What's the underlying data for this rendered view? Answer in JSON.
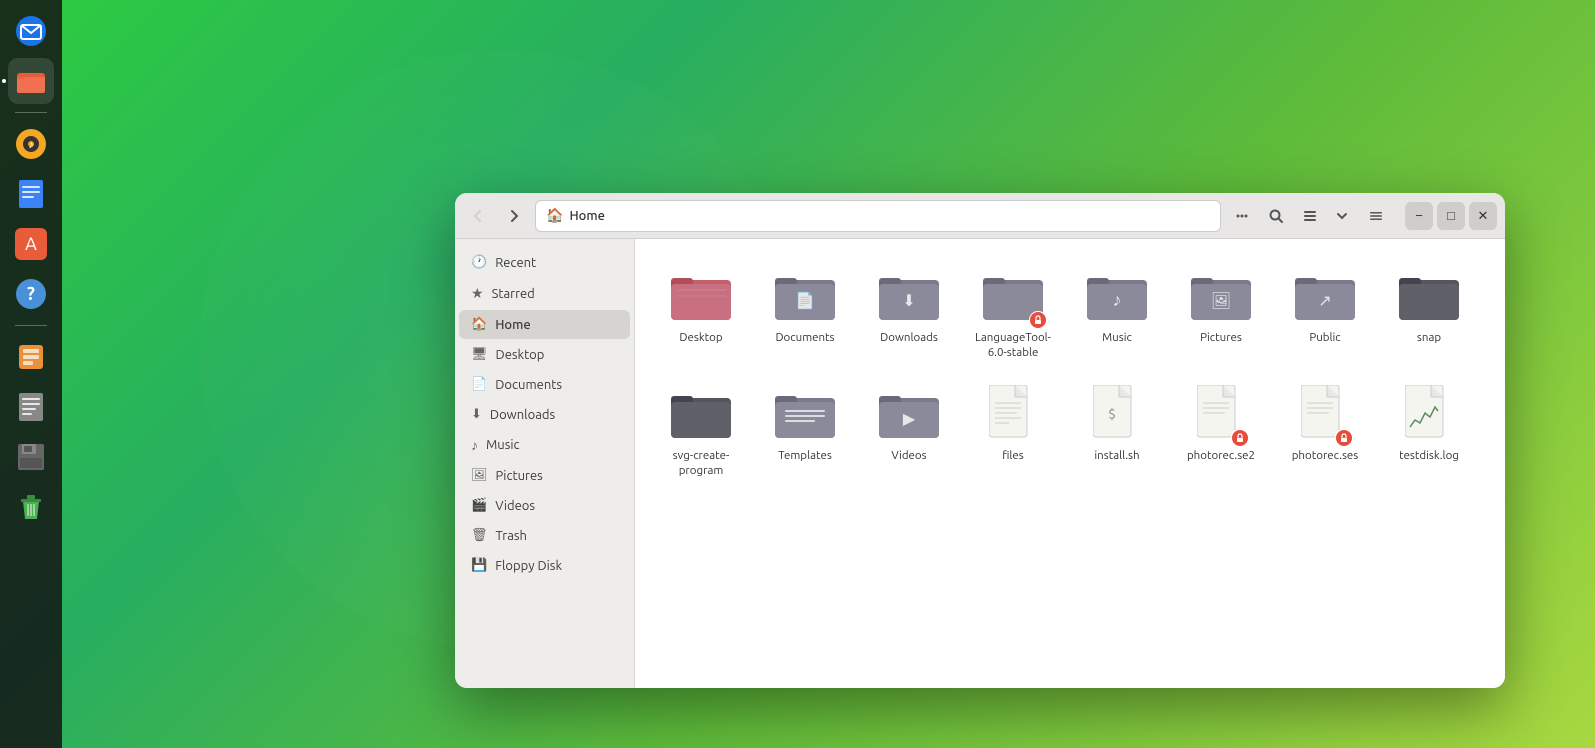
{
  "desktop": {
    "background": "green-gradient"
  },
  "dock": {
    "items": [
      {
        "id": "email",
        "label": "Thunderbird Email",
        "color": "#1a73e8"
      },
      {
        "id": "files",
        "label": "Files",
        "color": "#e85c3a",
        "active": true
      },
      {
        "id": "sound",
        "label": "Rhythmbox",
        "color": "#f5a623"
      },
      {
        "id": "writer",
        "label": "LibreOffice Writer",
        "color": "#3b82f6"
      },
      {
        "id": "appstore",
        "label": "App Store",
        "color": "#e85c3a"
      },
      {
        "id": "help",
        "label": "Help",
        "color": "#4a90d9"
      },
      {
        "id": "manager2",
        "label": "Archive Manager",
        "color": "#e8903a"
      },
      {
        "id": "text",
        "label": "Text Editor",
        "color": "#888"
      },
      {
        "id": "floppy",
        "label": "Floppy Manager",
        "color": "#666"
      },
      {
        "id": "trash",
        "label": "Trash",
        "color": "#4caf50"
      }
    ]
  },
  "window": {
    "title": "Home",
    "address_icon": "🏠",
    "nav": {
      "back_disabled": true,
      "forward_disabled": false
    }
  },
  "sidebar": {
    "items": [
      {
        "id": "recent",
        "label": "Recent",
        "icon": "🕐"
      },
      {
        "id": "starred",
        "label": "Starred",
        "icon": "★"
      },
      {
        "id": "home",
        "label": "Home",
        "icon": "🏠",
        "active": true
      },
      {
        "id": "desktop",
        "label": "Desktop",
        "icon": "🖥"
      },
      {
        "id": "documents",
        "label": "Documents",
        "icon": "📄"
      },
      {
        "id": "downloads",
        "label": "Downloads",
        "icon": "⬇"
      },
      {
        "id": "music",
        "label": "Music",
        "icon": "♪"
      },
      {
        "id": "pictures",
        "label": "Pictures",
        "icon": "🖼"
      },
      {
        "id": "videos",
        "label": "Videos",
        "icon": "🎬"
      },
      {
        "id": "trash",
        "label": "Trash",
        "icon": "🗑"
      },
      {
        "id": "floppy",
        "label": "Floppy Disk",
        "icon": "💾"
      }
    ]
  },
  "files": {
    "items": [
      {
        "id": "desktop",
        "label": "Desktop",
        "type": "folder",
        "color_body": "#c45f6a",
        "color_tab": "#b34e58",
        "emblem": null
      },
      {
        "id": "documents",
        "label": "Documents",
        "type": "folder",
        "color_body": "#7a7a8a",
        "color_tab": "#6a6a7a",
        "emblem": "📄"
      },
      {
        "id": "downloads",
        "label": "Downloads",
        "type": "folder",
        "color_body": "#7a7a8a",
        "color_tab": "#6a6a7a",
        "emblem": "⬇"
      },
      {
        "id": "languagetool",
        "label": "LanguageTool-6.0-stable",
        "type": "folder",
        "color_body": "#7a7a8a",
        "color_tab": "#6a6a7a",
        "emblem": "🔒"
      },
      {
        "id": "music",
        "label": "Music",
        "type": "folder",
        "color_body": "#7a7a8a",
        "color_tab": "#6a6a7a",
        "emblem": "♪"
      },
      {
        "id": "pictures",
        "label": "Pictures",
        "type": "folder",
        "color_body": "#7a7a8a",
        "color_tab": "#6a6a7a",
        "emblem": "🖼"
      },
      {
        "id": "public",
        "label": "Public",
        "type": "folder",
        "color_body": "#7a7a8a",
        "color_tab": "#6a6a7a",
        "emblem": "↗"
      },
      {
        "id": "snap",
        "label": "snap",
        "type": "folder",
        "color_body": "#555560",
        "color_tab": "#444450",
        "emblem": null
      },
      {
        "id": "svgcreate",
        "label": "svg-create-program",
        "type": "folder",
        "color_body": "#555560",
        "color_tab": "#444450",
        "emblem": null
      },
      {
        "id": "templates",
        "label": "Templates",
        "type": "folder",
        "color_body": "#7a7a8a",
        "color_tab": "#6a6a7a",
        "emblem": "☰"
      },
      {
        "id": "videos",
        "label": "Videos",
        "type": "folder",
        "color_body": "#7a7a8a",
        "color_tab": "#6a6a7a",
        "emblem": "🎬"
      },
      {
        "id": "files",
        "label": "files",
        "type": "text-file",
        "emblem": null
      },
      {
        "id": "installsh",
        "label": "install.sh",
        "type": "script-file",
        "emblem": null
      },
      {
        "id": "photorec2",
        "label": "photorec.se2",
        "type": "doc-file",
        "emblem": "lock",
        "color_accent": "#e74c3c"
      },
      {
        "id": "photorecses",
        "label": "photorec.ses",
        "type": "doc-file",
        "emblem": "lock",
        "color_accent": "#e74c3c"
      },
      {
        "id": "testdisk",
        "label": "testdisk.log",
        "type": "log-file",
        "emblem": null
      }
    ]
  },
  "labels": {
    "recent": "Recent",
    "starred": "Starred",
    "home": "Home",
    "desktop_sidebar": "Desktop",
    "documents_sidebar": "Documents",
    "downloads_sidebar": "Downloads",
    "music_sidebar": "Music",
    "pictures_sidebar": "Pictures",
    "videos_sidebar": "Videos",
    "trash_sidebar": "Trash",
    "floppy_sidebar": "Floppy Disk",
    "window_title": "Home",
    "minimize": "−",
    "maximize": "□",
    "close": "✕"
  }
}
